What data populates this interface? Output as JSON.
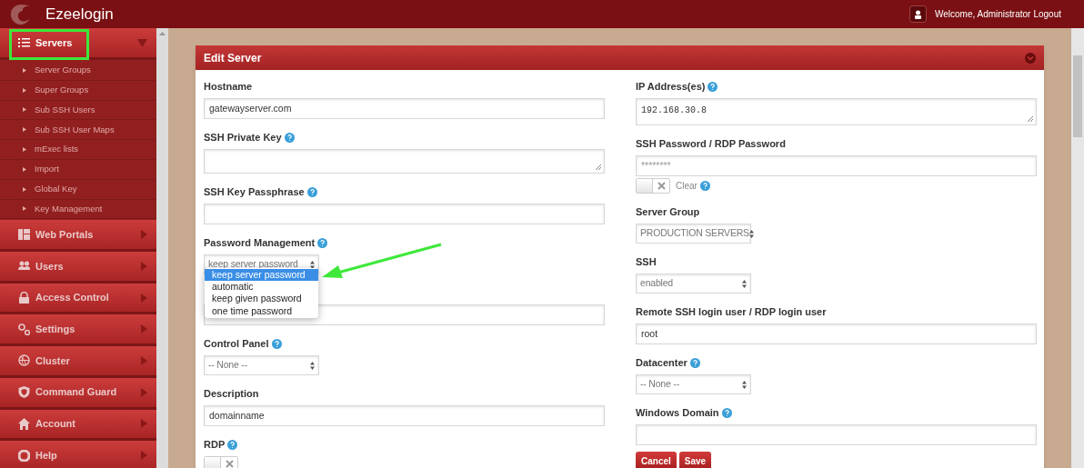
{
  "header": {
    "logo_text": "Ezeelogin",
    "welcome": "Welcome, Administrator",
    "logout": "Logout"
  },
  "sidebar": {
    "items": [
      {
        "label": "Servers",
        "expanded": true,
        "highlighted": true,
        "children": [
          {
            "label": "Server Groups"
          },
          {
            "label": "Super Groups"
          },
          {
            "label": "Sub SSH Users"
          },
          {
            "label": "Sub SSH User Maps"
          },
          {
            "label": "mExec lists"
          },
          {
            "label": "Import"
          },
          {
            "label": "Global Key"
          },
          {
            "label": "Key Management"
          }
        ]
      },
      {
        "label": "Web Portals",
        "expanded": false
      },
      {
        "label": "Users",
        "expanded": false
      },
      {
        "label": "Access Control",
        "expanded": false
      },
      {
        "label": "Settings",
        "expanded": false
      },
      {
        "label": "Cluster",
        "expanded": false
      },
      {
        "label": "Command Guard",
        "expanded": false
      },
      {
        "label": "Account",
        "expanded": false
      },
      {
        "label": "Help",
        "expanded": false
      }
    ]
  },
  "panel": {
    "title": "Edit Server",
    "left_fields": [
      {
        "kind": "text",
        "label": "Hostname",
        "help": false,
        "value": "gatewayserver.com"
      },
      {
        "kind": "textarea",
        "label": "SSH Private Key",
        "help": true
      },
      {
        "kind": "text",
        "label": "SSH Key Passphrase",
        "help": true
      },
      {
        "kind": "select",
        "label": "Password Management",
        "help": true,
        "value": "keep server password",
        "open": true,
        "options": [
          {
            "label": "keep server password",
            "selected": true
          },
          {
            "label": "automatic",
            "selected": false
          },
          {
            "label": "keep given password",
            "selected": false
          },
          {
            "label": "one time password",
            "selected": false
          }
        ]
      },
      {
        "kind": "text"
      },
      {
        "kind": "select",
        "label": "Control Panel",
        "help": true,
        "value": "-- None --"
      },
      {
        "kind": "text",
        "label": "Description",
        "help": false,
        "value": "domainname"
      },
      {
        "kind": "toggle",
        "label": "RDP",
        "help": true,
        "on": false
      }
    ],
    "right_fields": [
      {
        "kind": "textarea",
        "label": "IP Address(es)",
        "help": true,
        "value": "192.168.30.8",
        "mono": true
      },
      {
        "kind": "password",
        "label": "SSH Password / RDP Password",
        "help": false,
        "value": "********",
        "toggle_label": "Clear",
        "toggle_help": true,
        "on": false
      },
      {
        "kind": "select",
        "label": "Server Group",
        "help": false,
        "value": "PRODUCTION SERVERS"
      },
      {
        "kind": "select",
        "label": "SSH",
        "help": false,
        "value": "enabled"
      },
      {
        "kind": "text",
        "label": "Remote SSH login user / RDP login user",
        "help": false,
        "value": "root"
      },
      {
        "kind": "select",
        "label": "Datacenter",
        "help": true,
        "value": "-- None --"
      },
      {
        "kind": "text",
        "label": "Windows Domain",
        "help": true
      }
    ],
    "buttons": [
      {
        "label": "Cancel"
      },
      {
        "label": "Save"
      }
    ]
  }
}
